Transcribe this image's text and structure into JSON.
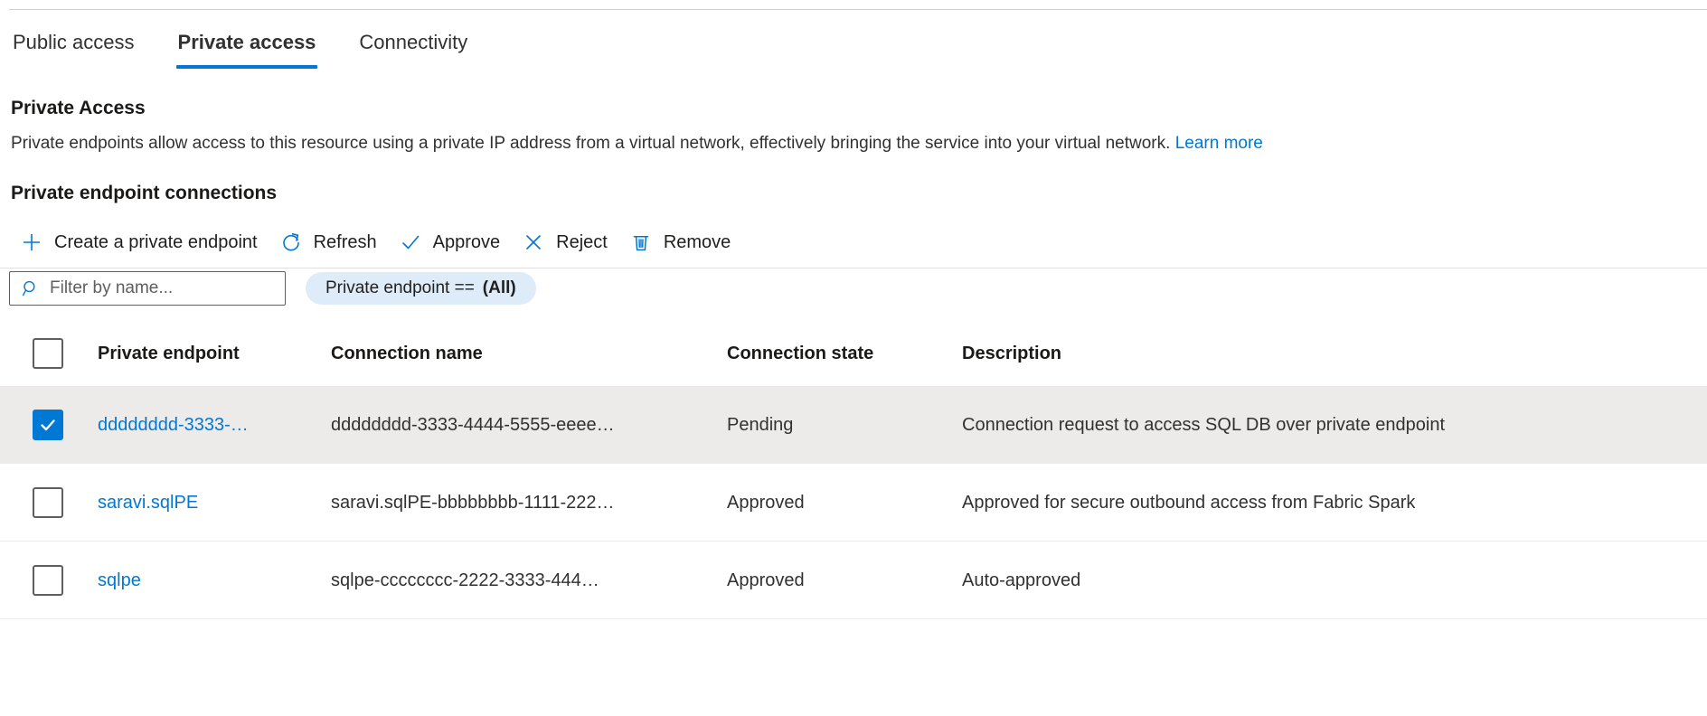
{
  "tabs": [
    {
      "label": "Public access",
      "selected": false
    },
    {
      "label": "Private access",
      "selected": true
    },
    {
      "label": "Connectivity",
      "selected": false
    }
  ],
  "section": {
    "title": "Private Access",
    "description": "Private endpoints allow access to this resource using a private IP address from a virtual network, effectively bringing the service into your virtual network.",
    "learn_more": "Learn more",
    "subtitle": "Private endpoint connections"
  },
  "toolbar": {
    "create_label": "Create a private endpoint",
    "refresh_label": "Refresh",
    "approve_label": "Approve",
    "reject_label": "Reject",
    "remove_label": "Remove",
    "create_icon": "plus-icon",
    "refresh_icon": "refresh-icon",
    "approve_icon": "checkmark-icon",
    "reject_icon": "x-icon",
    "remove_icon": "trash-icon"
  },
  "filters": {
    "search_placeholder": "Filter by name...",
    "search_value": "",
    "search_icon": "search-icon",
    "pill_label": "Private endpoint ==",
    "pill_value": "(All)"
  },
  "table": {
    "columns": {
      "endpoint": "Private endpoint",
      "connection_name": "Connection name",
      "connection_state": "Connection state",
      "description": "Description"
    },
    "rows": [
      {
        "selected": true,
        "endpoint": "dddddddd-3333-…",
        "connection_name": "dddddddd-3333-4444-5555-eeee…",
        "connection_state": "Pending",
        "description": "Connection request to access SQL DB over private endpoint"
      },
      {
        "selected": false,
        "endpoint": "saravi.sqlPE",
        "connection_name": "saravi.sqlPE-bbbbbbbb-1111-222…",
        "connection_state": "Approved",
        "description": "Approved for secure outbound access from Fabric Spark"
      },
      {
        "selected": false,
        "endpoint": "sqlpe",
        "connection_name": "sqlpe-cccccccc-2222-3333-444…",
        "connection_state": "Approved",
        "description": "Auto-approved"
      }
    ]
  },
  "colors": {
    "accent": "#0078d4",
    "link": "#0078d4",
    "selected_row": "#edebe9",
    "pill_background": "#deecf9",
    "divider": "#e1dfdd"
  }
}
